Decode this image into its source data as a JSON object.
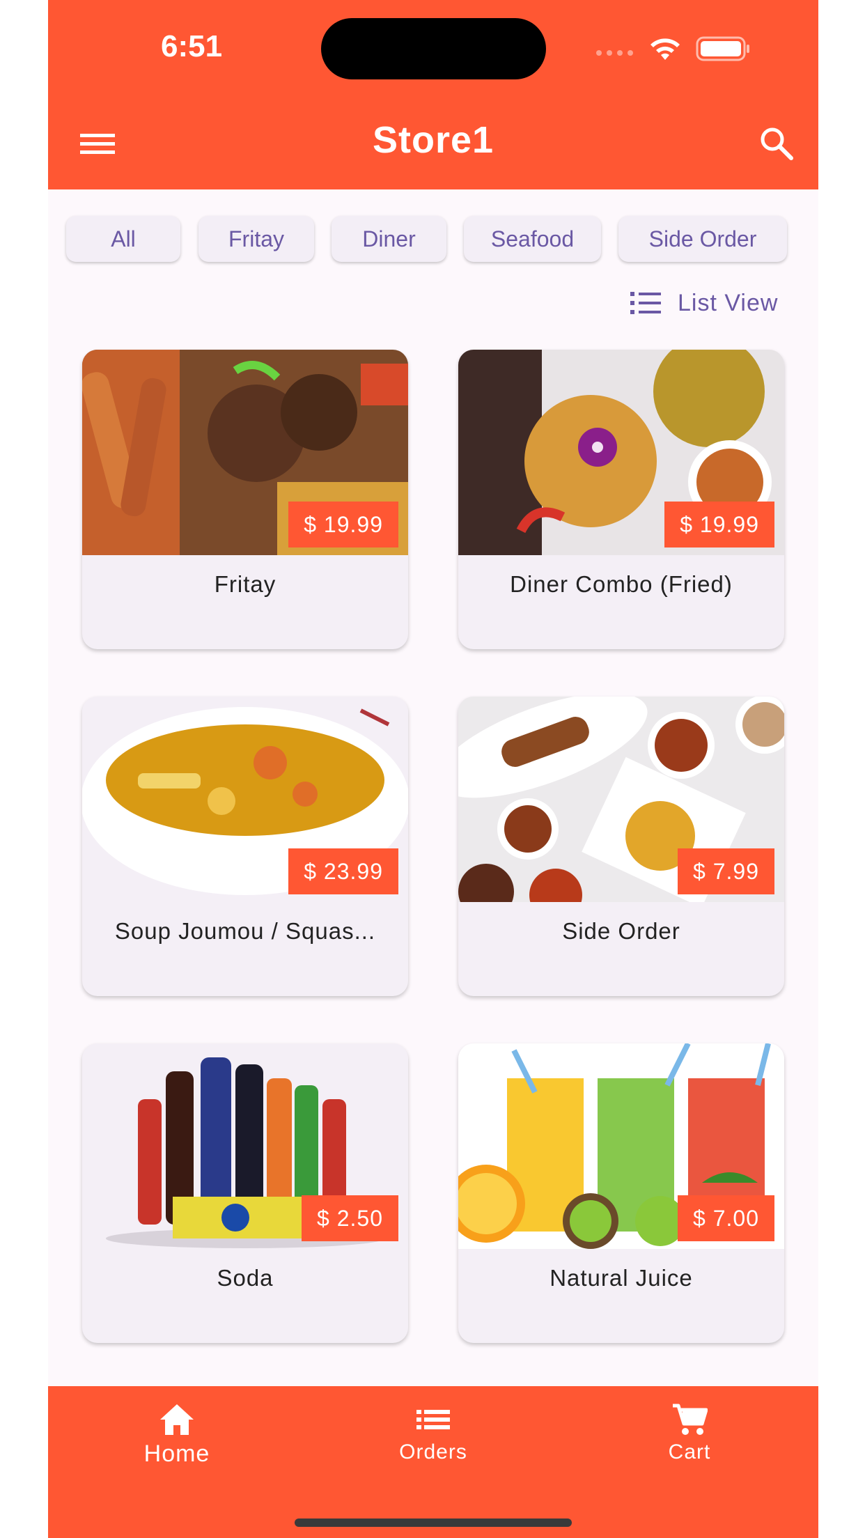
{
  "status_bar": {
    "time": "6:51"
  },
  "app_bar": {
    "title": "Store1",
    "menu_icon": "hamburger-menu-icon",
    "search_icon": "search-icon"
  },
  "categories": [
    "All",
    "Fritay",
    "Diner",
    "Seafood",
    "Side Order"
  ],
  "view_toggle": {
    "label": "List View",
    "icon": "list-icon"
  },
  "products": [
    {
      "name": "Fritay",
      "price": "$ 19.99"
    },
    {
      "name": "Diner Combo (Fried)",
      "price": "$ 19.99"
    },
    {
      "name": "Soup Joumou / Squas...",
      "price": "$ 23.99"
    },
    {
      "name": "Side Order",
      "price": "$ 7.99"
    },
    {
      "name": "Soda",
      "price": "$ 2.50"
    },
    {
      "name": "Natural Juice",
      "price": "$ 7.00"
    }
  ],
  "bottom_nav": [
    {
      "label": "Home",
      "icon": "home-icon"
    },
    {
      "label": "Orders",
      "icon": "list-icon"
    },
    {
      "label": "Cart",
      "icon": "cart-icon"
    }
  ],
  "colors": {
    "primary": "#ff5733",
    "chip_text": "#6a58a4",
    "background": "#fdf8fc",
    "card": "#f4eff6"
  }
}
